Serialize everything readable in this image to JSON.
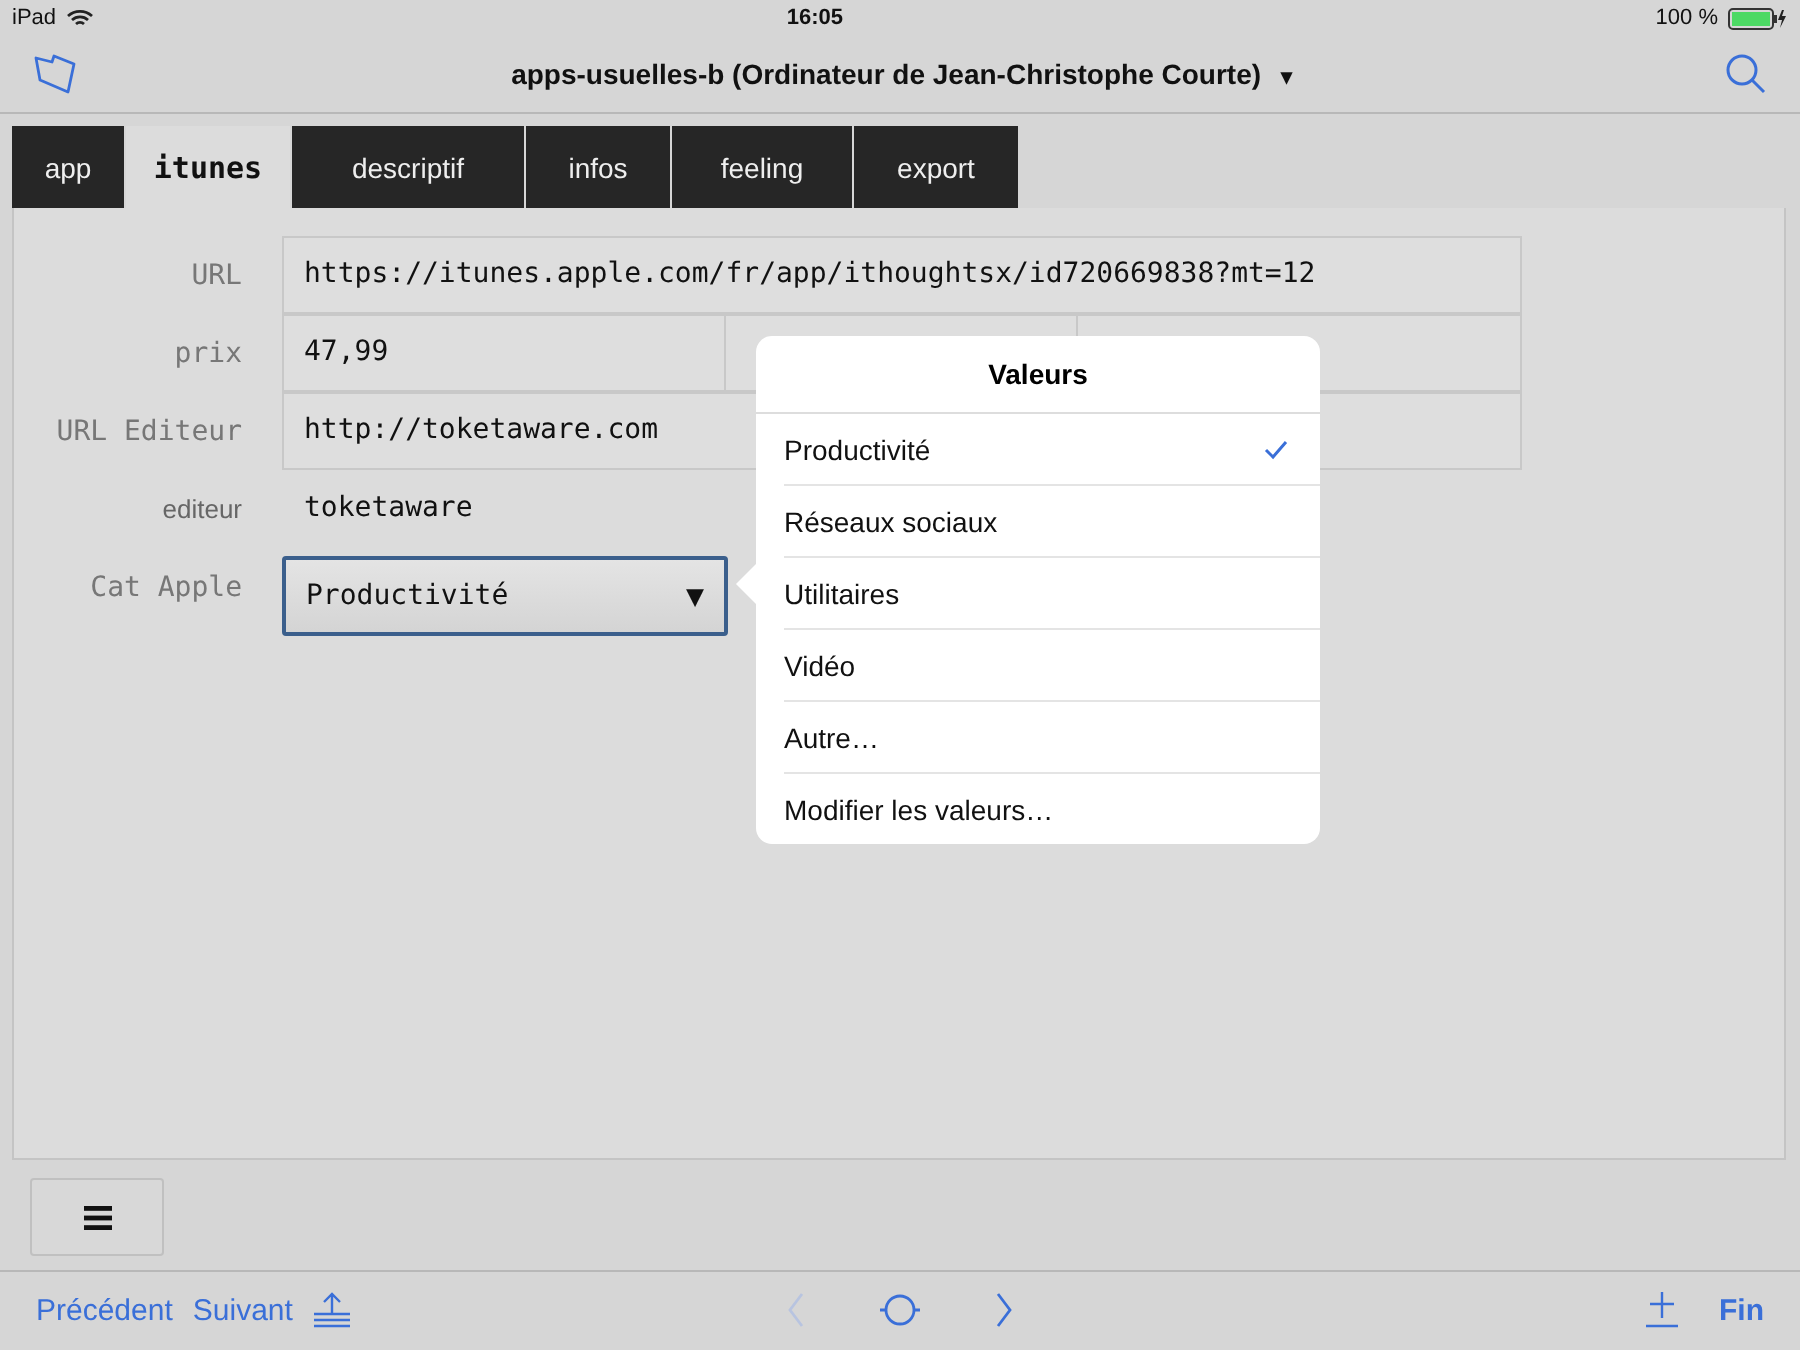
{
  "status_bar": {
    "device": "iPad",
    "time": "16:05",
    "battery": "100 %"
  },
  "nav": {
    "title": "apps-usuelles-b (Ordinateur de Jean-Christophe Courte)",
    "caret": "▾"
  },
  "tabs": [
    {
      "label": "app",
      "selected": false
    },
    {
      "label": "itunes",
      "selected": true
    },
    {
      "label": "descriptif",
      "selected": false
    },
    {
      "label": "infos",
      "selected": false
    },
    {
      "label": "feeling",
      "selected": false
    },
    {
      "label": "export",
      "selected": false
    }
  ],
  "form": [
    {
      "label": "URL",
      "label_mono": true,
      "kind": "text",
      "values": [
        "https://itunes.apple.com/fr/app/ithoughtsx/id720669838?mt=12"
      ]
    },
    {
      "label": "prix",
      "label_mono": true,
      "kind": "split",
      "values": [
        "47,99"
      ]
    },
    {
      "label": "URL Editeur",
      "label_mono": true,
      "kind": "text",
      "values": [
        "http://toketaware.com"
      ]
    },
    {
      "label": "editeur",
      "label_mono": false,
      "kind": "plain",
      "values": [
        "toketaware"
      ]
    },
    {
      "label": "Cat Apple",
      "label_mono": true,
      "kind": "select",
      "values": [
        "Productivité"
      ],
      "caret": "▼"
    }
  ],
  "popover": {
    "title": "Valeurs",
    "items": [
      {
        "label": "Productivité",
        "selected": true
      },
      {
        "label": "Réseaux sociaux",
        "selected": false
      },
      {
        "label": "Utilitaires",
        "selected": false
      },
      {
        "label": "Vidéo",
        "selected": false
      },
      {
        "label": "Autre…",
        "selected": false
      },
      {
        "label": "Modifier les valeurs…",
        "selected": false
      }
    ]
  },
  "toolbar": {
    "previous": "Précédent",
    "next": "Suivant",
    "done": "Fin"
  }
}
